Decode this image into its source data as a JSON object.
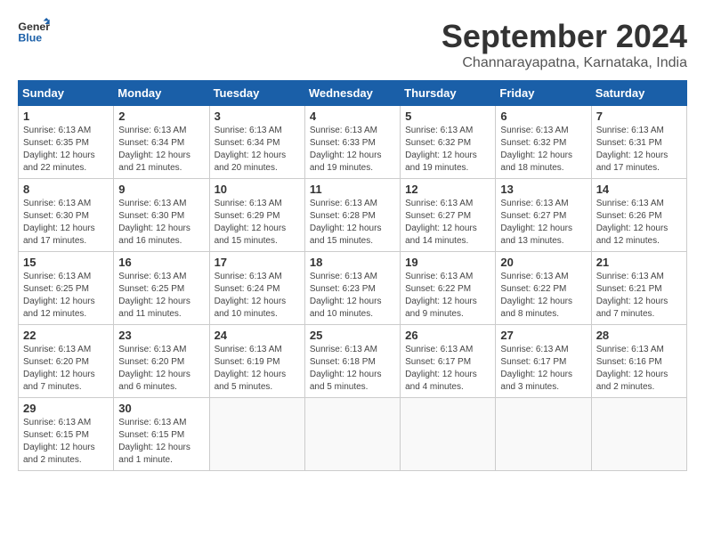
{
  "logo": {
    "text_general": "General",
    "text_blue": "Blue"
  },
  "title": "September 2024",
  "location": "Channarayapatna, Karnataka, India",
  "days_of_week": [
    "Sunday",
    "Monday",
    "Tuesday",
    "Wednesday",
    "Thursday",
    "Friday",
    "Saturday"
  ],
  "weeks": [
    [
      {
        "day": "1",
        "sunrise": "6:13 AM",
        "sunset": "6:35 PM",
        "daylight": "12 hours and 22 minutes."
      },
      {
        "day": "2",
        "sunrise": "6:13 AM",
        "sunset": "6:34 PM",
        "daylight": "12 hours and 21 minutes."
      },
      {
        "day": "3",
        "sunrise": "6:13 AM",
        "sunset": "6:34 PM",
        "daylight": "12 hours and 20 minutes."
      },
      {
        "day": "4",
        "sunrise": "6:13 AM",
        "sunset": "6:33 PM",
        "daylight": "12 hours and 19 minutes."
      },
      {
        "day": "5",
        "sunrise": "6:13 AM",
        "sunset": "6:32 PM",
        "daylight": "12 hours and 19 minutes."
      },
      {
        "day": "6",
        "sunrise": "6:13 AM",
        "sunset": "6:32 PM",
        "daylight": "12 hours and 18 minutes."
      },
      {
        "day": "7",
        "sunrise": "6:13 AM",
        "sunset": "6:31 PM",
        "daylight": "12 hours and 17 minutes."
      }
    ],
    [
      {
        "day": "8",
        "sunrise": "6:13 AM",
        "sunset": "6:30 PM",
        "daylight": "12 hours and 17 minutes."
      },
      {
        "day": "9",
        "sunrise": "6:13 AM",
        "sunset": "6:30 PM",
        "daylight": "12 hours and 16 minutes."
      },
      {
        "day": "10",
        "sunrise": "6:13 AM",
        "sunset": "6:29 PM",
        "daylight": "12 hours and 15 minutes."
      },
      {
        "day": "11",
        "sunrise": "6:13 AM",
        "sunset": "6:28 PM",
        "daylight": "12 hours and 15 minutes."
      },
      {
        "day": "12",
        "sunrise": "6:13 AM",
        "sunset": "6:27 PM",
        "daylight": "12 hours and 14 minutes."
      },
      {
        "day": "13",
        "sunrise": "6:13 AM",
        "sunset": "6:27 PM",
        "daylight": "12 hours and 13 minutes."
      },
      {
        "day": "14",
        "sunrise": "6:13 AM",
        "sunset": "6:26 PM",
        "daylight": "12 hours and 12 minutes."
      }
    ],
    [
      {
        "day": "15",
        "sunrise": "6:13 AM",
        "sunset": "6:25 PM",
        "daylight": "12 hours and 12 minutes."
      },
      {
        "day": "16",
        "sunrise": "6:13 AM",
        "sunset": "6:25 PM",
        "daylight": "12 hours and 11 minutes."
      },
      {
        "day": "17",
        "sunrise": "6:13 AM",
        "sunset": "6:24 PM",
        "daylight": "12 hours and 10 minutes."
      },
      {
        "day": "18",
        "sunrise": "6:13 AM",
        "sunset": "6:23 PM",
        "daylight": "12 hours and 10 minutes."
      },
      {
        "day": "19",
        "sunrise": "6:13 AM",
        "sunset": "6:22 PM",
        "daylight": "12 hours and 9 minutes."
      },
      {
        "day": "20",
        "sunrise": "6:13 AM",
        "sunset": "6:22 PM",
        "daylight": "12 hours and 8 minutes."
      },
      {
        "day": "21",
        "sunrise": "6:13 AM",
        "sunset": "6:21 PM",
        "daylight": "12 hours and 7 minutes."
      }
    ],
    [
      {
        "day": "22",
        "sunrise": "6:13 AM",
        "sunset": "6:20 PM",
        "daylight": "12 hours and 7 minutes."
      },
      {
        "day": "23",
        "sunrise": "6:13 AM",
        "sunset": "6:20 PM",
        "daylight": "12 hours and 6 minutes."
      },
      {
        "day": "24",
        "sunrise": "6:13 AM",
        "sunset": "6:19 PM",
        "daylight": "12 hours and 5 minutes."
      },
      {
        "day": "25",
        "sunrise": "6:13 AM",
        "sunset": "6:18 PM",
        "daylight": "12 hours and 5 minutes."
      },
      {
        "day": "26",
        "sunrise": "6:13 AM",
        "sunset": "6:17 PM",
        "daylight": "12 hours and 4 minutes."
      },
      {
        "day": "27",
        "sunrise": "6:13 AM",
        "sunset": "6:17 PM",
        "daylight": "12 hours and 3 minutes."
      },
      {
        "day": "28",
        "sunrise": "6:13 AM",
        "sunset": "6:16 PM",
        "daylight": "12 hours and 2 minutes."
      }
    ],
    [
      {
        "day": "29",
        "sunrise": "6:13 AM",
        "sunset": "6:15 PM",
        "daylight": "12 hours and 2 minutes."
      },
      {
        "day": "30",
        "sunrise": "6:13 AM",
        "sunset": "6:15 PM",
        "daylight": "12 hours and 1 minute."
      },
      null,
      null,
      null,
      null,
      null
    ]
  ],
  "labels": {
    "sunrise": "Sunrise:",
    "sunset": "Sunset:",
    "daylight": "Daylight:"
  }
}
